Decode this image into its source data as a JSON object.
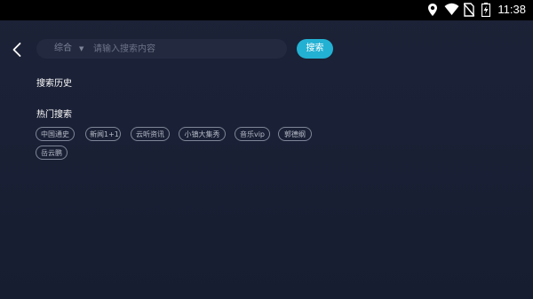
{
  "status_bar": {
    "time": "11:38",
    "icons": [
      "location-icon",
      "wifi-icon",
      "no-sim-icon",
      "battery-charging-icon"
    ]
  },
  "search": {
    "category": "综合",
    "placeholder": "请输入搜索内容",
    "value": "",
    "button_label": "搜索"
  },
  "history": {
    "title": "搜索历史"
  },
  "hot": {
    "title": "热门搜索",
    "tags": [
      "中国通史",
      "新闻1+1",
      "云听资讯",
      "小镇大集秀",
      "音乐vip",
      "郭德纲",
      "岳云鹏"
    ]
  },
  "colors": {
    "accent": "#22b1d3",
    "background": "#1b2136",
    "tag_border": "#7f8698"
  }
}
